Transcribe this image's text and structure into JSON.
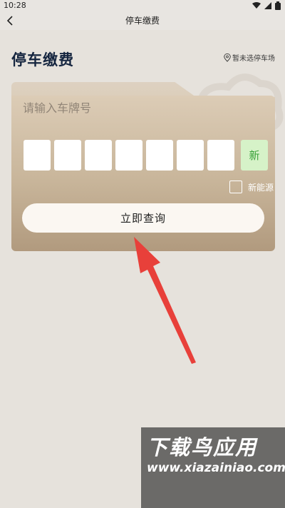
{
  "status_bar": {
    "time": "10:28",
    "icons": [
      "wifi-icon",
      "signal-icon",
      "battery-icon"
    ]
  },
  "header": {
    "title": "停车缴费"
  },
  "page": {
    "heading": "停车缴费",
    "lot_link": "暂未选停车场",
    "plate_prompt": "请输入车牌号",
    "plate_slots": 7,
    "new_energy_slot": "新",
    "new_energy_label": "新能源",
    "query_button": "立即查询"
  },
  "watermark": {
    "title": "下载鸟应用",
    "url": "www.xiazainiao.com"
  },
  "colors": {
    "heading": "#15253f",
    "accent_green": "#3aa23a",
    "arrow": "#e8403a"
  }
}
